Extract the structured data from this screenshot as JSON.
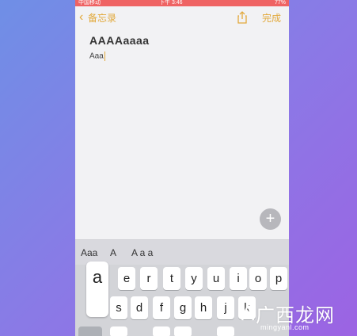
{
  "statusbar": {
    "carrier": "中国移动",
    "time": "下午 3:46",
    "battery": "77%"
  },
  "navbar": {
    "back_label": "备忘录",
    "done_label": "完成"
  },
  "note": {
    "title": "AAAAaaaa",
    "body": "Aaa"
  },
  "add_button": {
    "label": "+"
  },
  "format_bar": {
    "options": [
      "Aaa",
      "A",
      "A a a"
    ]
  },
  "keyboard": {
    "popup_key": "a",
    "row1": [
      "e",
      "r",
      "t",
      "y",
      "u",
      "i",
      "o",
      "p"
    ],
    "row2": [
      "s",
      "d",
      "f",
      "g",
      "h",
      "j",
      "k"
    ]
  },
  "watermark": {
    "text": "广西龙网",
    "url": "mingyanl.com"
  },
  "colors": {
    "accent": "#e2a93b",
    "statusbar": "#ef6363",
    "background_start": "#6f8fe6",
    "background_end": "#9c63e3"
  }
}
